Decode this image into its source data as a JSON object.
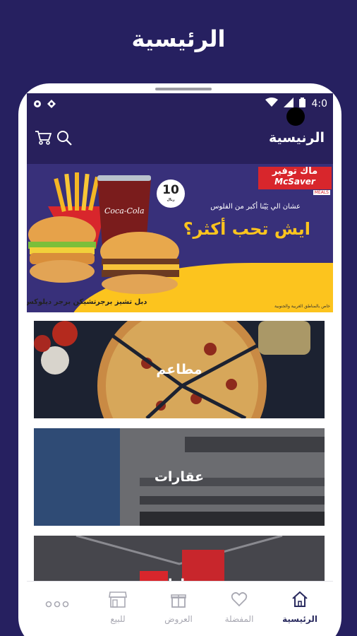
{
  "page": {
    "title": "الرئيسية"
  },
  "status_bar": {
    "time": "4:0"
  },
  "app_bar": {
    "title": "الرنيسية",
    "icons": [
      "search-icon",
      "cart-icon"
    ]
  },
  "banner": {
    "brand_ar": "ماك توفير",
    "brand_en": "McSaver",
    "brand_tag": "MEALS",
    "subtitle": "عشان الي يَيّنا أكبر من الفلوس",
    "headline": "ايش تحب أكثر؟",
    "price": "10",
    "price_unit": "ريال",
    "drink_logo": "Coca-Cola",
    "caption_1": "دبل تشيز برجر",
    "caption_2": "تشيكن برجر ديلوكس",
    "legal": "خاص بالمناطق الغربية والجنوبية"
  },
  "categories": [
    {
      "label": "مطاعم"
    },
    {
      "label": "عقارات"
    },
    {
      "label": "سيارات"
    }
  ],
  "bottom_nav": [
    {
      "label": "الرئيسية",
      "icon": "home-icon",
      "active": true
    },
    {
      "label": "المفضلة",
      "icon": "heart-icon",
      "active": false
    },
    {
      "label": "العروض",
      "icon": "gift-icon",
      "active": false
    },
    {
      "label": "للبيع",
      "icon": "store-icon",
      "active": false
    },
    {
      "label": "",
      "icon": "more-icon",
      "active": false
    }
  ],
  "colors": {
    "background": "#262060",
    "app_bar": "#28205c",
    "banner_purple": "#38307a",
    "banner_yellow": "#fcc41e",
    "brand_red": "#d8262c",
    "nav_active": "#2a2b5f",
    "nav_inactive": "#a8a8b2"
  }
}
